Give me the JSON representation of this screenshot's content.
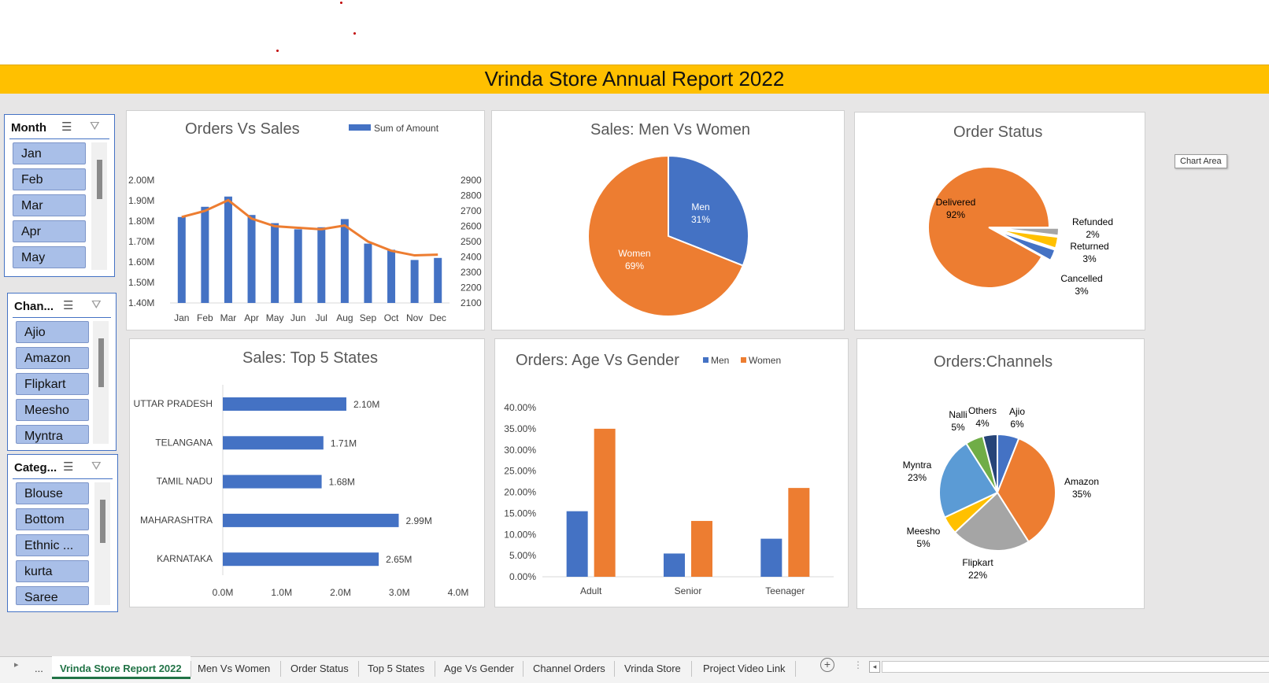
{
  "report_title": "Vrinda Store Annual Report 2022",
  "slicers": {
    "month": {
      "title": "Month",
      "items": [
        "Jan",
        "Feb",
        "Mar",
        "Apr",
        "May"
      ]
    },
    "channel": {
      "title": "Chan...",
      "items": [
        "Ajio",
        "Amazon",
        "Flipkart",
        "Meesho",
        "Myntra"
      ]
    },
    "category": {
      "title": "Categ...",
      "items": [
        "Blouse",
        "Bottom",
        "Ethnic ...",
        "kurta",
        "Saree"
      ]
    }
  },
  "tooltip": "Chart Area",
  "colors": {
    "blue": "#4472C4",
    "orange": "#ED7D31",
    "gray": "#A5A5A5",
    "yellow": "#FFC000",
    "lightblue": "#5B9BD5",
    "green": "#70AD47",
    "navy": "#264478",
    "banner": "#FFC000"
  },
  "sheet_tabs": {
    "ellipsis": "...",
    "items": [
      "Vrinda Store Report 2022",
      "Men Vs Women",
      "Order Status",
      "Top 5 States",
      "Age Vs Gender",
      "Channel Orders",
      "Vrinda Store",
      "Project Video Link"
    ],
    "active": "Vrinda Store Report 2022"
  },
  "chart_data": [
    {
      "id": "orders_vs_sales",
      "type": "bar",
      "title": "Orders Vs Sales",
      "legend": [
        "Sum of Amount"
      ],
      "categories": [
        "Jan",
        "Feb",
        "Mar",
        "Apr",
        "May",
        "Jun",
        "Jul",
        "Aug",
        "Sep",
        "Oct",
        "Nov",
        "Dec"
      ],
      "series": [
        {
          "name": "Sum of Amount",
          "type": "bar",
          "axis": "left",
          "values": [
            1.82,
            1.87,
            1.92,
            1.83,
            1.79,
            1.76,
            1.77,
            1.81,
            1.69,
            1.66,
            1.61,
            1.62
          ]
        },
        {
          "type": "line",
          "axis": "right",
          "values": [
            2660,
            2700,
            2770,
            2650,
            2600,
            2590,
            2580,
            2605,
            2500,
            2440,
            2410,
            2415
          ]
        }
      ],
      "y_left": {
        "ticks": [
          "1.40M",
          "1.50M",
          "1.60M",
          "1.70M",
          "1.80M",
          "1.90M",
          "2.00M"
        ],
        "range": [
          1.4,
          2.0
        ]
      },
      "y_right": {
        "ticks": [
          "2100",
          "2200",
          "2300",
          "2400",
          "2500",
          "2600",
          "2700",
          "2800",
          "2900"
        ],
        "range": [
          2100,
          2900
        ]
      },
      "legend_position": "top-right",
      "grid": false
    },
    {
      "id": "men_vs_women",
      "type": "pie",
      "title": "Sales: Men Vs Women",
      "slices": [
        {
          "label": "Men",
          "value": 31,
          "pct": "31%"
        },
        {
          "label": "Women",
          "value": 69,
          "pct": "69%"
        }
      ]
    },
    {
      "id": "order_status",
      "type": "pie",
      "title": "Order Status",
      "slices": [
        {
          "label": "Delivered",
          "value": 92,
          "pct": "92%"
        },
        {
          "label": "Refunded",
          "value": 2,
          "pct": "2%"
        },
        {
          "label": "Returned",
          "value": 3,
          "pct": "3%"
        },
        {
          "label": "Cancelled",
          "value": 3,
          "pct": "3%"
        }
      ]
    },
    {
      "id": "top5_states",
      "type": "bar",
      "orientation": "horizontal",
      "title": "Sales: Top 5 States",
      "categories": [
        "UTTAR PRADESH",
        "TELANGANA",
        "TAMIL NADU",
        "MAHARASHTRA",
        "KARNATAKA"
      ],
      "values": [
        2.1,
        1.71,
        1.68,
        2.99,
        2.65
      ],
      "labels": [
        "2.10M",
        "1.71M",
        "1.68M",
        "2.99M",
        "2.65M"
      ],
      "x_ticks": [
        "0.0M",
        "1.0M",
        "2.0M",
        "3.0M",
        "4.0M"
      ],
      "xlim": [
        0,
        4
      ]
    },
    {
      "id": "age_vs_gender",
      "type": "bar",
      "title": "Orders: Age Vs Gender",
      "categories": [
        "Adult",
        "Senior",
        "Teenager"
      ],
      "series": [
        {
          "name": "Men",
          "values": [
            15.5,
            5.5,
            9.0
          ]
        },
        {
          "name": "Women",
          "values": [
            35.0,
            13.2,
            21.0
          ]
        }
      ],
      "y_ticks": [
        "0.00%",
        "5.00%",
        "10.00%",
        "15.00%",
        "20.00%",
        "25.00%",
        "30.00%",
        "35.00%",
        "40.00%"
      ],
      "ylim": [
        0,
        40
      ],
      "legend_position": "top-right"
    },
    {
      "id": "channels",
      "type": "pie",
      "title": "Orders:Channels",
      "slices": [
        {
          "label": "Ajio",
          "value": 6,
          "pct": "6%"
        },
        {
          "label": "Amazon",
          "value": 35,
          "pct": "35%"
        },
        {
          "label": "Flipkart",
          "value": 22,
          "pct": "22%"
        },
        {
          "label": "Meesho",
          "value": 5,
          "pct": "5%"
        },
        {
          "label": "Myntra",
          "value": 23,
          "pct": "23%"
        },
        {
          "label": "Nalli",
          "value": 5,
          "pct": "5%"
        },
        {
          "label": "Others",
          "value": 4,
          "pct": "4%"
        }
      ]
    }
  ]
}
